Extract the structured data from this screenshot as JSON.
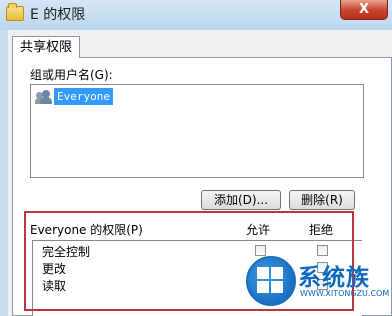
{
  "window": {
    "title": "E 的权限",
    "close_glyph": "X",
    "folder_icon": "folder-icon",
    "close_icon": "close-icon"
  },
  "tabs": [
    {
      "label": "共享权限"
    }
  ],
  "groups": {
    "label": "组或用户名(G):",
    "items": [
      {
        "icon": "user-group-icon",
        "label": "Everyone"
      }
    ]
  },
  "buttons": {
    "add": "添加(D)...",
    "remove": "删除(R)"
  },
  "permissions": {
    "heading": "Everyone 的权限(P)",
    "allow_label": "允许",
    "deny_label": "拒绝",
    "rows": [
      {
        "name": "完全控制",
        "allow": false,
        "deny": false
      },
      {
        "name": "更改",
        "allow": false,
        "deny": false
      },
      {
        "name": "读取",
        "allow": false,
        "deny": false
      }
    ]
  },
  "watermark": {
    "brand": "系统族",
    "url": "WWW.XITONGZU.COM"
  },
  "colors": {
    "highlight": "#3399ff",
    "annotation_red": "#c0333a",
    "watermark_blue": "#0d68c0"
  }
}
